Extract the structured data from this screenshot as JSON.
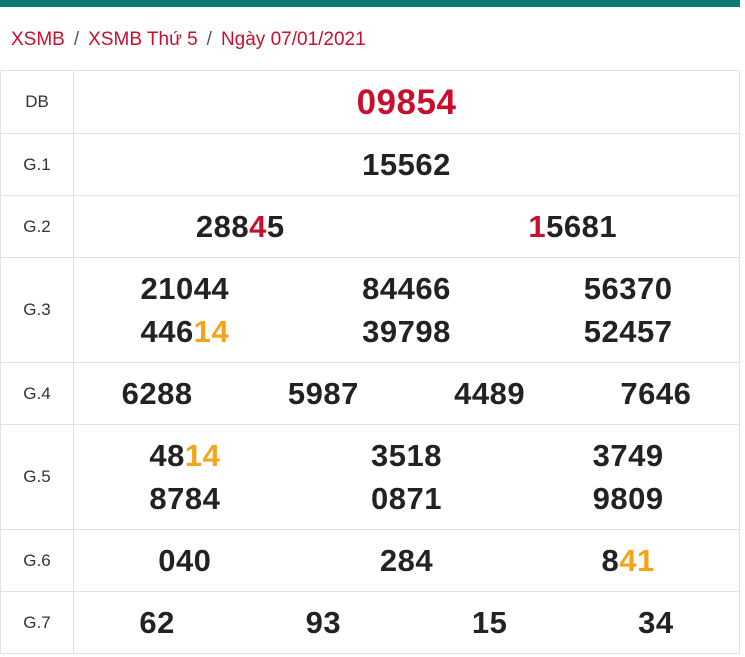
{
  "colors": {
    "accent": "#0d7a72",
    "red": "#c8102e",
    "orange": "#f5a31a"
  },
  "breadcrumb": {
    "home": "XSMB",
    "day": "XSMB Thứ 5",
    "date": "Ngày 07/01/2021"
  },
  "rows": [
    {
      "label": "DB",
      "numbers": [
        [
          "09854"
        ]
      ]
    },
    {
      "label": "G.1",
      "numbers": [
        [
          "15562"
        ]
      ]
    },
    {
      "label": "G.2",
      "numbers": [
        [
          "288",
          "4",
          "5"
        ],
        [
          "",
          "1",
          "5681"
        ]
      ]
    },
    {
      "label": "G.3",
      "numbers": [
        [
          "21044"
        ],
        [
          "84466"
        ],
        [
          "56370"
        ],
        [
          "446",
          "14",
          ""
        ],
        [
          "39798"
        ],
        [
          "52457"
        ]
      ]
    },
    {
      "label": "G.4",
      "numbers": [
        [
          "6288"
        ],
        [
          "5987"
        ],
        [
          "4489"
        ],
        [
          "7646"
        ]
      ]
    },
    {
      "label": "G.5",
      "numbers": [
        [
          "48",
          "14",
          ""
        ],
        [
          "3518"
        ],
        [
          "3749"
        ],
        [
          "8784"
        ],
        [
          "0871"
        ],
        [
          "9809"
        ]
      ]
    },
    {
      "label": "G.6",
      "numbers": [
        [
          "040"
        ],
        [
          "284"
        ],
        [
          "8",
          "41",
          ""
        ]
      ]
    },
    {
      "label": "G.7",
      "numbers": [
        [
          "62"
        ],
        [
          "93"
        ],
        [
          "15"
        ],
        [
          "34"
        ]
      ]
    }
  ]
}
